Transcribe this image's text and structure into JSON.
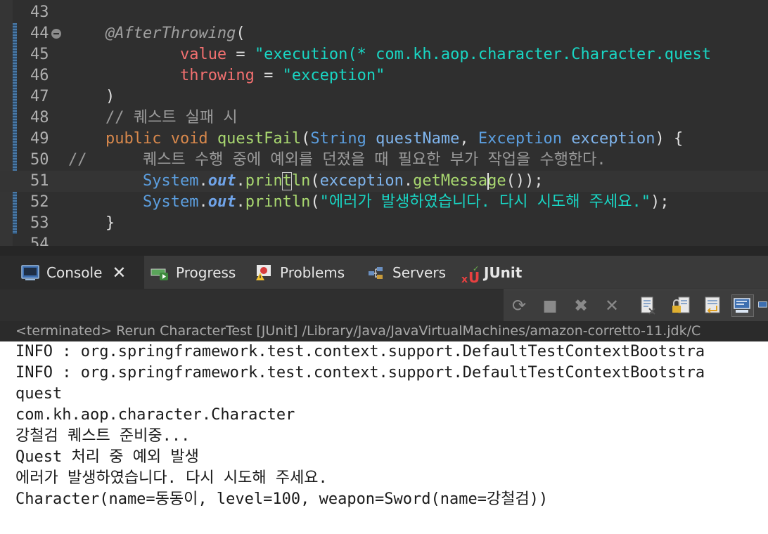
{
  "editor": {
    "lines": [
      {
        "num": "43",
        "segments": []
      },
      {
        "num": "44",
        "segments": [
          {
            "c": "anno",
            "t": "    @AfterThrowing"
          },
          {
            "c": "plain",
            "t": "("
          }
        ]
      },
      {
        "num": "45",
        "segments": [
          {
            "c": "plain",
            "t": "            "
          },
          {
            "c": "field",
            "t": "value"
          },
          {
            "c": "plain",
            "t": " = "
          },
          {
            "c": "str",
            "t": "\"execution(* com.kh.aop.character.Character.quest"
          }
        ]
      },
      {
        "num": "46",
        "segments": [
          {
            "c": "plain",
            "t": "            "
          },
          {
            "c": "field",
            "t": "throwing"
          },
          {
            "c": "plain",
            "t": " = "
          },
          {
            "c": "str",
            "t": "\"exception\""
          }
        ]
      },
      {
        "num": "47",
        "segments": [
          {
            "c": "plain",
            "t": "    )"
          }
        ]
      },
      {
        "num": "48",
        "segments": [
          {
            "c": "cmt",
            "t": "    // 퀘스트 실패 시"
          }
        ]
      },
      {
        "num": "49",
        "segments": [
          {
            "c": "plain",
            "t": "    "
          },
          {
            "c": "kw",
            "t": "public void "
          },
          {
            "c": "method",
            "t": "questFail"
          },
          {
            "c": "plain",
            "t": "("
          },
          {
            "c": "type",
            "t": "String "
          },
          {
            "c": "ident",
            "t": "questName"
          },
          {
            "c": "plain",
            "t": ", "
          },
          {
            "c": "type",
            "t": "Exception "
          },
          {
            "c": "ident",
            "t": "exception"
          },
          {
            "c": "plain",
            "t": ") {"
          }
        ]
      },
      {
        "num": "50",
        "segments": [
          {
            "c": "cmt",
            "t": "//      퀘스트 수행 중에 예외를 던졌을 때 필요한 부가 작업을 수행한다."
          }
        ]
      },
      {
        "num": "51",
        "segments": [
          {
            "c": "plain",
            "t": "        "
          },
          {
            "c": "type",
            "t": "System"
          },
          {
            "c": "plain",
            "t": "."
          },
          {
            "c": "sfield",
            "t": "out"
          },
          {
            "c": "plain",
            "t": "."
          },
          {
            "c": "method",
            "t": "println"
          },
          {
            "c": "plain",
            "t": "("
          },
          {
            "c": "ident",
            "t": "exception"
          },
          {
            "c": "plain",
            "t": "."
          },
          {
            "c": "method",
            "t": "getMessage"
          },
          {
            "c": "plain",
            "t": "());"
          }
        ]
      },
      {
        "num": "52",
        "segments": [
          {
            "c": "plain",
            "t": "        "
          },
          {
            "c": "type",
            "t": "System"
          },
          {
            "c": "plain",
            "t": "."
          },
          {
            "c": "sfield",
            "t": "out"
          },
          {
            "c": "plain",
            "t": "."
          },
          {
            "c": "method",
            "t": "println"
          },
          {
            "c": "plain",
            "t": "("
          },
          {
            "c": "str",
            "t": "\"에러가 발생하였습니다. 다시 시도해 주세요.\""
          },
          {
            "c": "plain",
            "t": ");"
          }
        ]
      },
      {
        "num": "53",
        "segments": [
          {
            "c": "plain",
            "t": "    }"
          }
        ]
      },
      {
        "num": "54",
        "segments": []
      }
    ],
    "current_line": "51"
  },
  "tabs": {
    "console": "Console",
    "progress": "Progress",
    "problems": "Problems",
    "servers": "Servers",
    "junit": "JUnit"
  },
  "status_line": "<terminated> Rerun CharacterTest [JUnit] /Library/Java/JavaVirtualMachines/amazon-corretto-11.jdk/C",
  "console_output": [
    "INFO : org.springframework.test.context.support.DefaultTestContextBootstra",
    "INFO : org.springframework.test.context.support.DefaultTestContextBootstra",
    "quest",
    "com.kh.aop.character.Character",
    "강철검 퀘스트 준비중...",
    "Quest 처리 중 예외 발생",
    "에러가 발생하였습니다. 다시 시도해 주세요.",
    "Character(name=동동이, level=100, weapon=Sword(name=강철검))"
  ],
  "colors": {
    "editor_bg": "#2f2f2f",
    "console_bg": "#ffffff",
    "tab_active": "#2b2b2b"
  }
}
